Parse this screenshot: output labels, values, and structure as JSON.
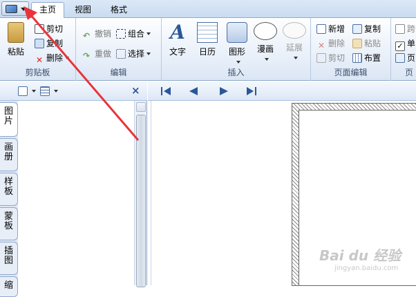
{
  "tabs": {
    "home": "主页",
    "view": "视图",
    "format": "格式"
  },
  "clipboard": {
    "label": "剪贴板",
    "paste": "粘贴",
    "cut": "剪切",
    "copy": "复制",
    "delete": "删除"
  },
  "edit": {
    "label": "编辑",
    "undo": "撤销",
    "redo": "重做",
    "group": "组合",
    "select": "选择"
  },
  "insert": {
    "label": "插入",
    "text": "文字",
    "calendar": "日历",
    "shape": "图形",
    "comic": "漫画",
    "extend": "延展"
  },
  "page_edit": {
    "label": "页面编辑",
    "new": "新增",
    "copy": "复制",
    "delete": "删除",
    "paste": "粘贴",
    "cut": "剪切",
    "layout": "布置"
  },
  "options": {
    "label": "页",
    "cb1": "跨",
    "cb2": "单",
    "cb3": "页"
  },
  "vtabs": [
    "图片",
    "画册",
    "样板",
    "蒙板",
    "插图",
    "缩"
  ],
  "watermark": {
    "main": "Bai du 经验",
    "sub": "jingyan.baidu.com"
  },
  "colors": {
    "accent": "#2b5797",
    "arrow": "#e8343a"
  }
}
